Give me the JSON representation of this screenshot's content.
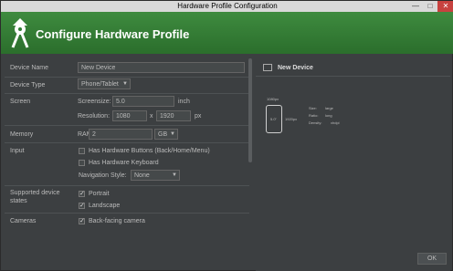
{
  "window": {
    "title": "Hardware Profile Configuration",
    "min": "—",
    "max": "□",
    "close": "✕"
  },
  "banner": {
    "title": "Configure Hardware Profile"
  },
  "form": {
    "device_name": {
      "label": "Device Name",
      "value": "New Device"
    },
    "device_type": {
      "label": "Device Type",
      "value": "Phone/Tablet"
    },
    "screen": {
      "label": "Screen",
      "screensize_label": "Screensize:",
      "screensize_value": "5.0",
      "screensize_unit": "inch",
      "resolution_label": "Resolution:",
      "res_w": "1080",
      "res_x": "x",
      "res_h": "1920",
      "res_unit": "px"
    },
    "memory": {
      "label": "Memory",
      "ram_label": "RAM:",
      "ram_value": "2",
      "ram_unit": "GB"
    },
    "input": {
      "label": "Input",
      "hw_buttons": "Has Hardware Buttons (Back/Home/Menu)",
      "hw_keyboard": "Has Hardware Keyboard",
      "nav_label": "Navigation Style:",
      "nav_value": "None"
    },
    "states": {
      "label": "Supported device states",
      "portrait": "Portrait",
      "landscape": "Landscape"
    },
    "cameras": {
      "label": "Cameras",
      "back": "Back-facing camera"
    }
  },
  "preview": {
    "title": "New Device",
    "width_px": "1080px",
    "height_px": "1920px",
    "diag": "5.0\"",
    "size_line": "Size:",
    "size_val": "large",
    "ratio_line": "Ratio:",
    "ratio_val": "long",
    "density_line": "Density:",
    "density_val": "xhdpi"
  },
  "buttons": {
    "ok": "OK"
  }
}
